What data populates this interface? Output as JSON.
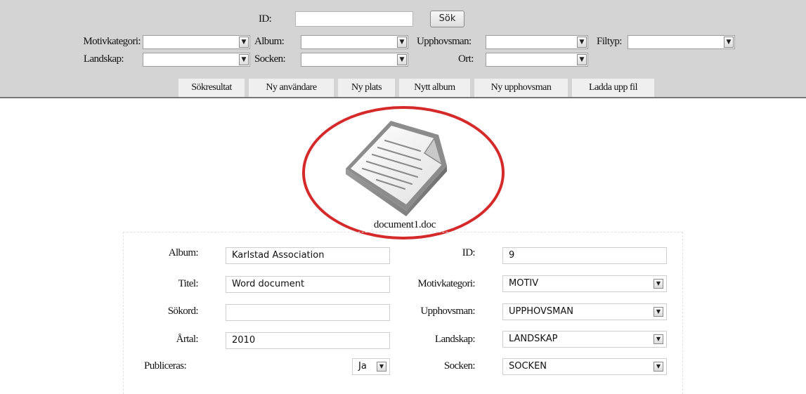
{
  "search": {
    "id_label": "ID:",
    "sok_label": "Sök",
    "motivkategori_label": "Motivkategori:",
    "album_label": "Album:",
    "upphovsman_label": "Upphovsman:",
    "filtyp_label": "Filtyp:",
    "landskap_label": "Landskap:",
    "socken_label": "Socken:",
    "ort_label": "Ort:"
  },
  "nav": {
    "tabs": [
      {
        "label": "Sökresultat"
      },
      {
        "label": "Ny användare"
      },
      {
        "label": "Ny plats"
      },
      {
        "label": "Nytt album"
      },
      {
        "label": "Ny upphovsman"
      },
      {
        "label": "Ladda upp fil"
      }
    ]
  },
  "file": {
    "name": "document1.doc",
    "icon": "document-icon",
    "highlight_color": "#d42a2a"
  },
  "form": {
    "album_label": "Album:",
    "album_value": "Karlstad Association",
    "titel_label": "Titel:",
    "titel_value": "Word document",
    "sokord_label": "Sökord:",
    "sokord_value": "",
    "artal_label": "Årtal:",
    "artal_value": "2010",
    "publiceras_label": "Publiceras:",
    "publiceras_value": "Ja",
    "id_label": "ID:",
    "id_value": "9",
    "motivkategori_label": "Motivkategori:",
    "motivkategori_value": "MOTIV",
    "upphovsman_label": "Upphovsman:",
    "upphovsman_value": "UPPHOVSMAN",
    "landskap_label": "Landskap:",
    "landskap_value": "LANDSKAP",
    "socken_label": "Socken:",
    "socken_value": "SOCKEN"
  }
}
